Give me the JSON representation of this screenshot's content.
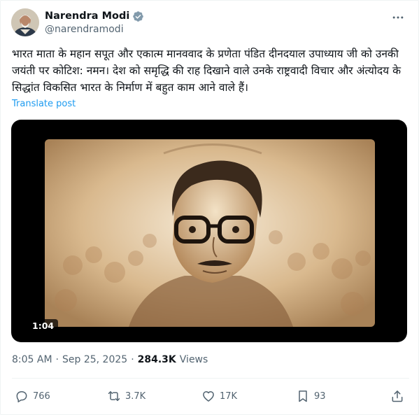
{
  "author": {
    "name": "Narendra Modi",
    "handle": "@narendramodi",
    "verified": true
  },
  "post": {
    "text": "भारत माता के महान सपूत और एकात्म मानववाद के प्रणेता पंडित दीनदयाल उपाध्याय जी को उनकी जयंती पर कोटिश: नमन। देश को समृद्धि की राह दिखाने वाले उनके राष्ट्रवादी विचार और अंत्योदय के सिद्धांत विकसित भारत के निर्माण में बहुत काम आने वाले हैं।",
    "translate_label": "Translate post"
  },
  "video": {
    "duration": "1:04"
  },
  "meta": {
    "time": "8:05 AM",
    "separator": "·",
    "date": "Sep 25, 2025",
    "views_count": "284.3K",
    "views_label": "Views"
  },
  "actions": {
    "replies": "766",
    "reposts": "3.7K",
    "likes": "17K",
    "bookmarks": "93"
  },
  "colors": {
    "accent": "#1d9bf0",
    "secondary_text": "#536471",
    "primary_text": "#0f1419"
  }
}
